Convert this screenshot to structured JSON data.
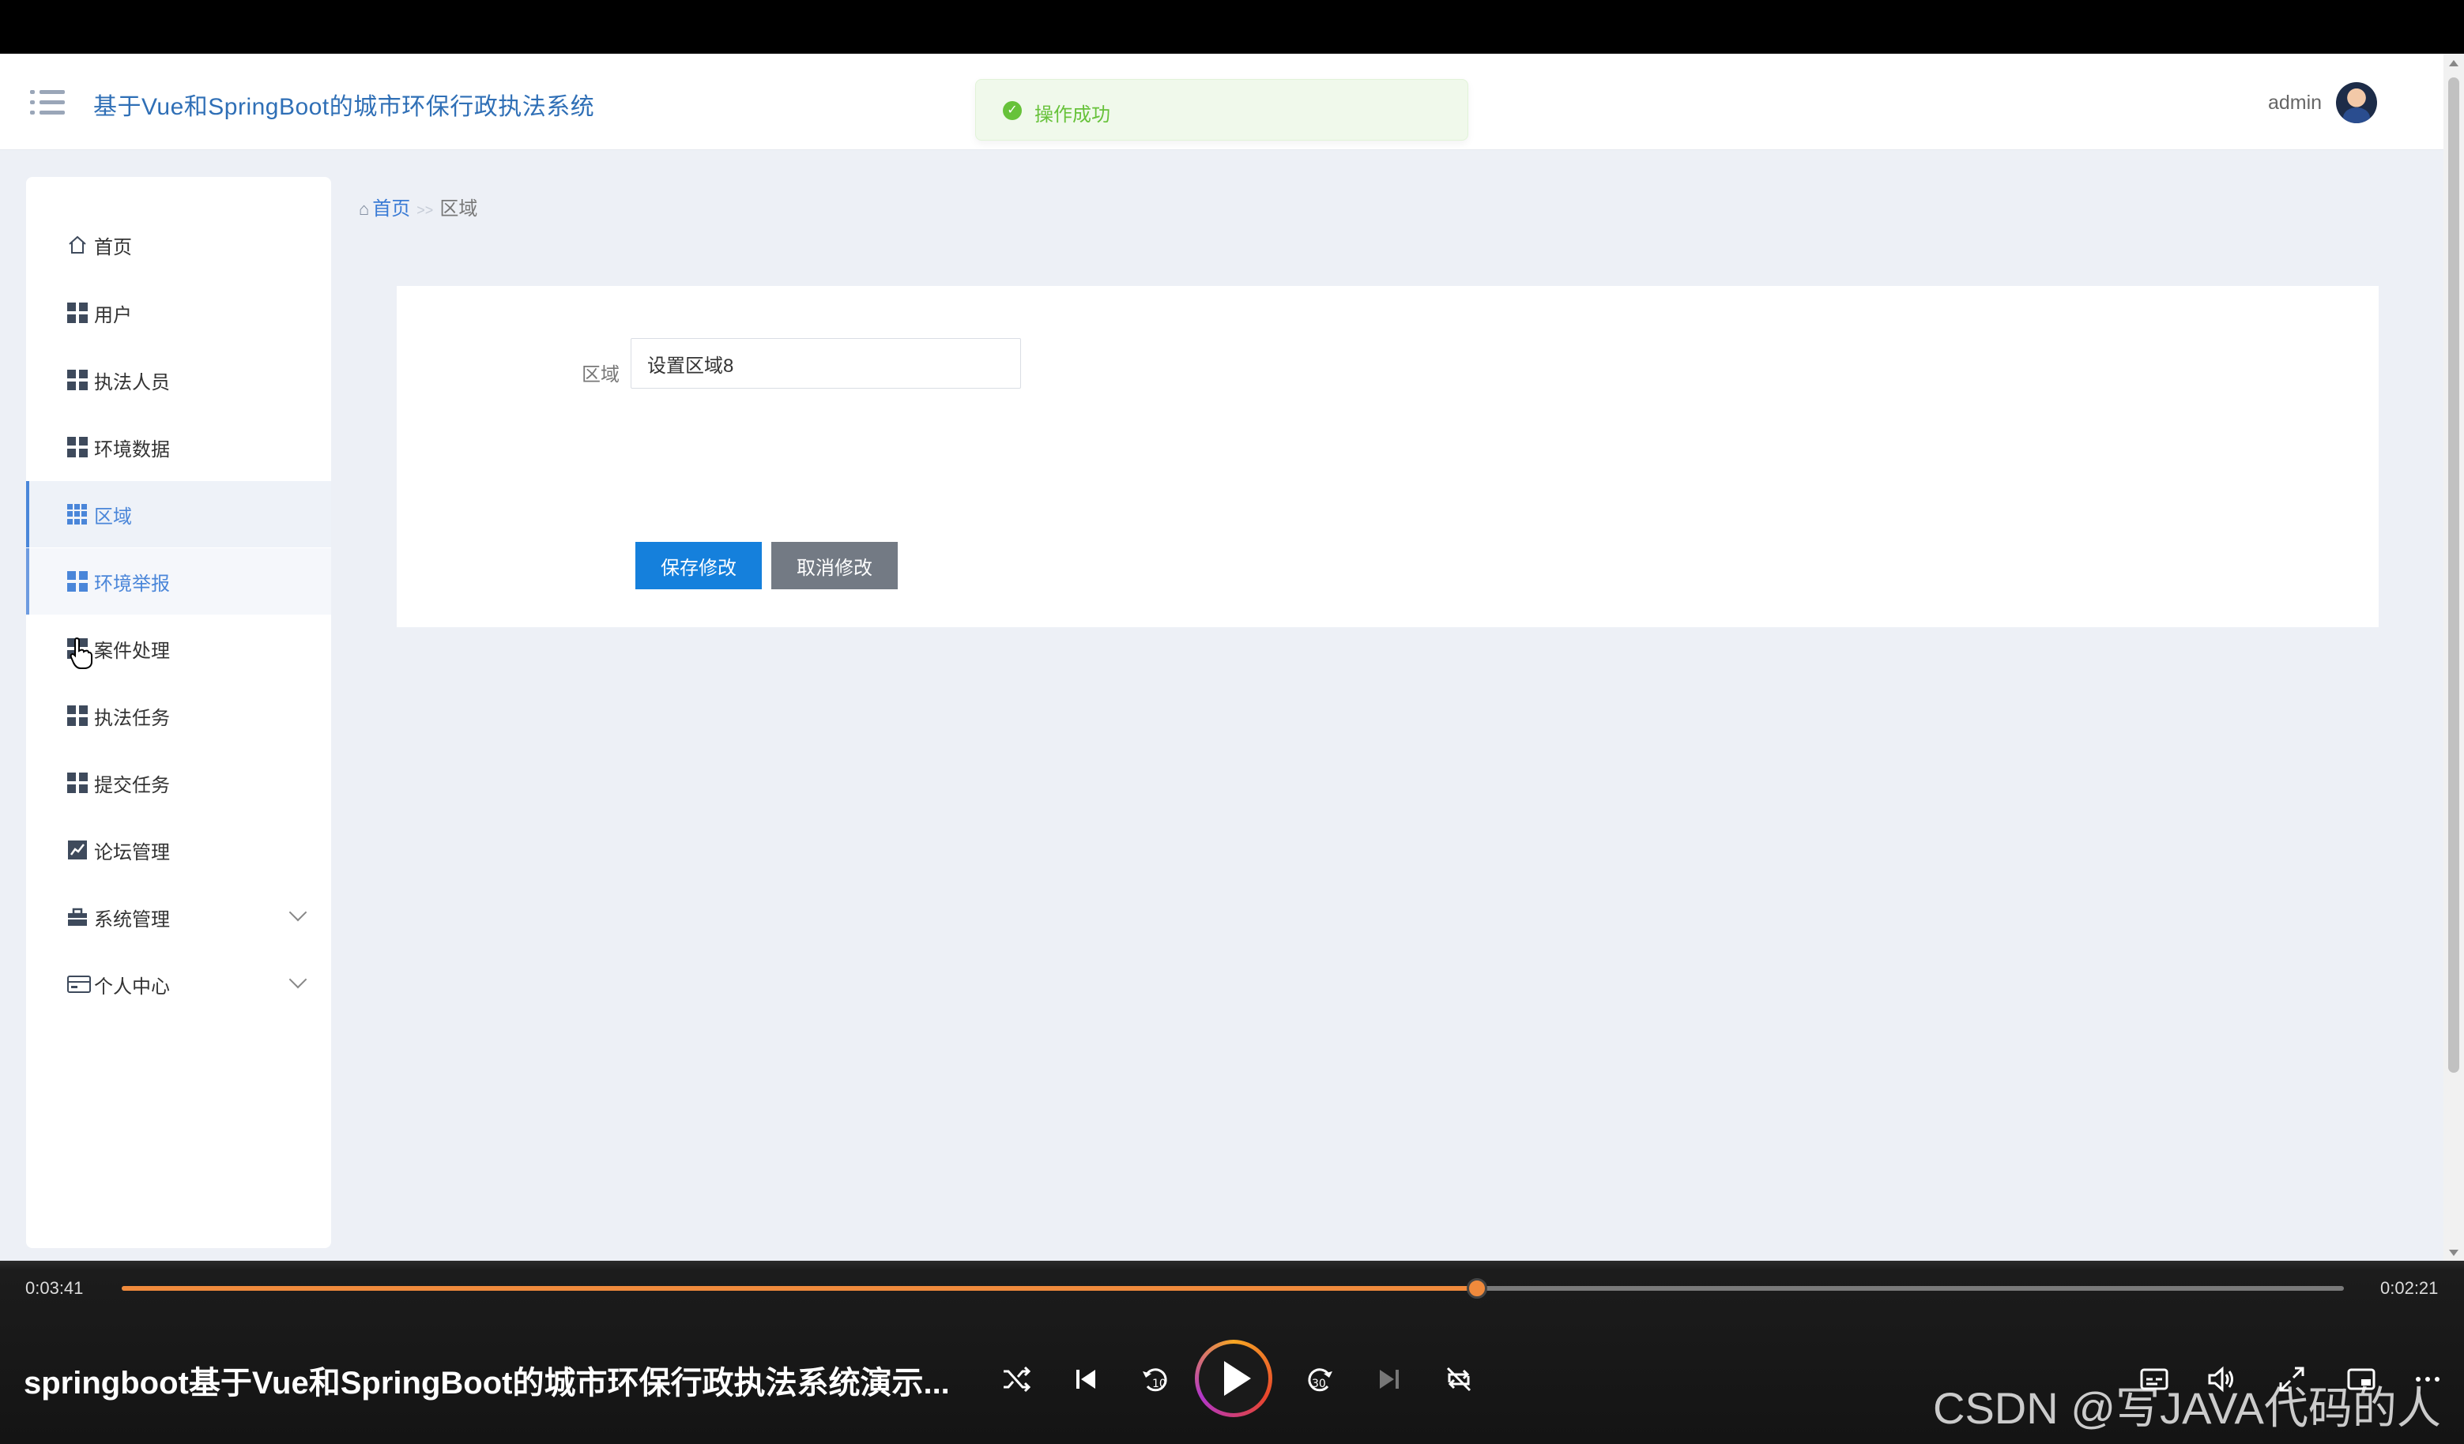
{
  "app": {
    "title": "基于Vue和SpringBoot的城市环保行政执法系统",
    "user_name": "admin"
  },
  "toast": {
    "message": "操作成功",
    "color": "#67c23a"
  },
  "sidebar": {
    "items": [
      {
        "label": "首页",
        "icon": "home-icon"
      },
      {
        "label": "用户",
        "icon": "grid-icon"
      },
      {
        "label": "执法人员",
        "icon": "grid-icon"
      },
      {
        "label": "环境数据",
        "icon": "grid-icon"
      },
      {
        "label": "区域",
        "icon": "grid-icon",
        "state": "active"
      },
      {
        "label": "环境举报",
        "icon": "grid-icon",
        "state": "hover"
      },
      {
        "label": "案件处理",
        "icon": "grid-icon"
      },
      {
        "label": "执法任务",
        "icon": "grid-icon"
      },
      {
        "label": "提交任务",
        "icon": "grid-icon"
      },
      {
        "label": "论坛管理",
        "icon": "chart-icon"
      },
      {
        "label": "系统管理",
        "icon": "briefcase-icon",
        "expandable": true
      },
      {
        "label": "个人中心",
        "icon": "card-icon",
        "expandable": true
      }
    ]
  },
  "breadcrumb": {
    "home": "首页",
    "separator": ">>",
    "current": "区域"
  },
  "form": {
    "field_label": "区域",
    "field_value": "设置区域8",
    "save_label": "保存修改",
    "cancel_label": "取消修改"
  },
  "colors": {
    "accent": "#1580dc",
    "title": "#2f6fb6",
    "cancel": "#737a84",
    "progress": "#f08a3c"
  },
  "player": {
    "time_current": "0:03:41",
    "time_remaining": "0:02:21",
    "progress_fraction": 0.61,
    "video_title": "springboot基于Vue和SpringBoot的城市环保行政执法系统演示...",
    "watermark": "CSDN @写JAVA代码的人",
    "controls": [
      "shuffle-icon",
      "previous-icon",
      "rewind-10-icon",
      "play-icon",
      "forward-30-icon",
      "next-icon",
      "repeat-icon",
      "subtitles-icon",
      "volume-icon",
      "expand-icon",
      "mini-player-icon",
      "more-icon"
    ]
  }
}
